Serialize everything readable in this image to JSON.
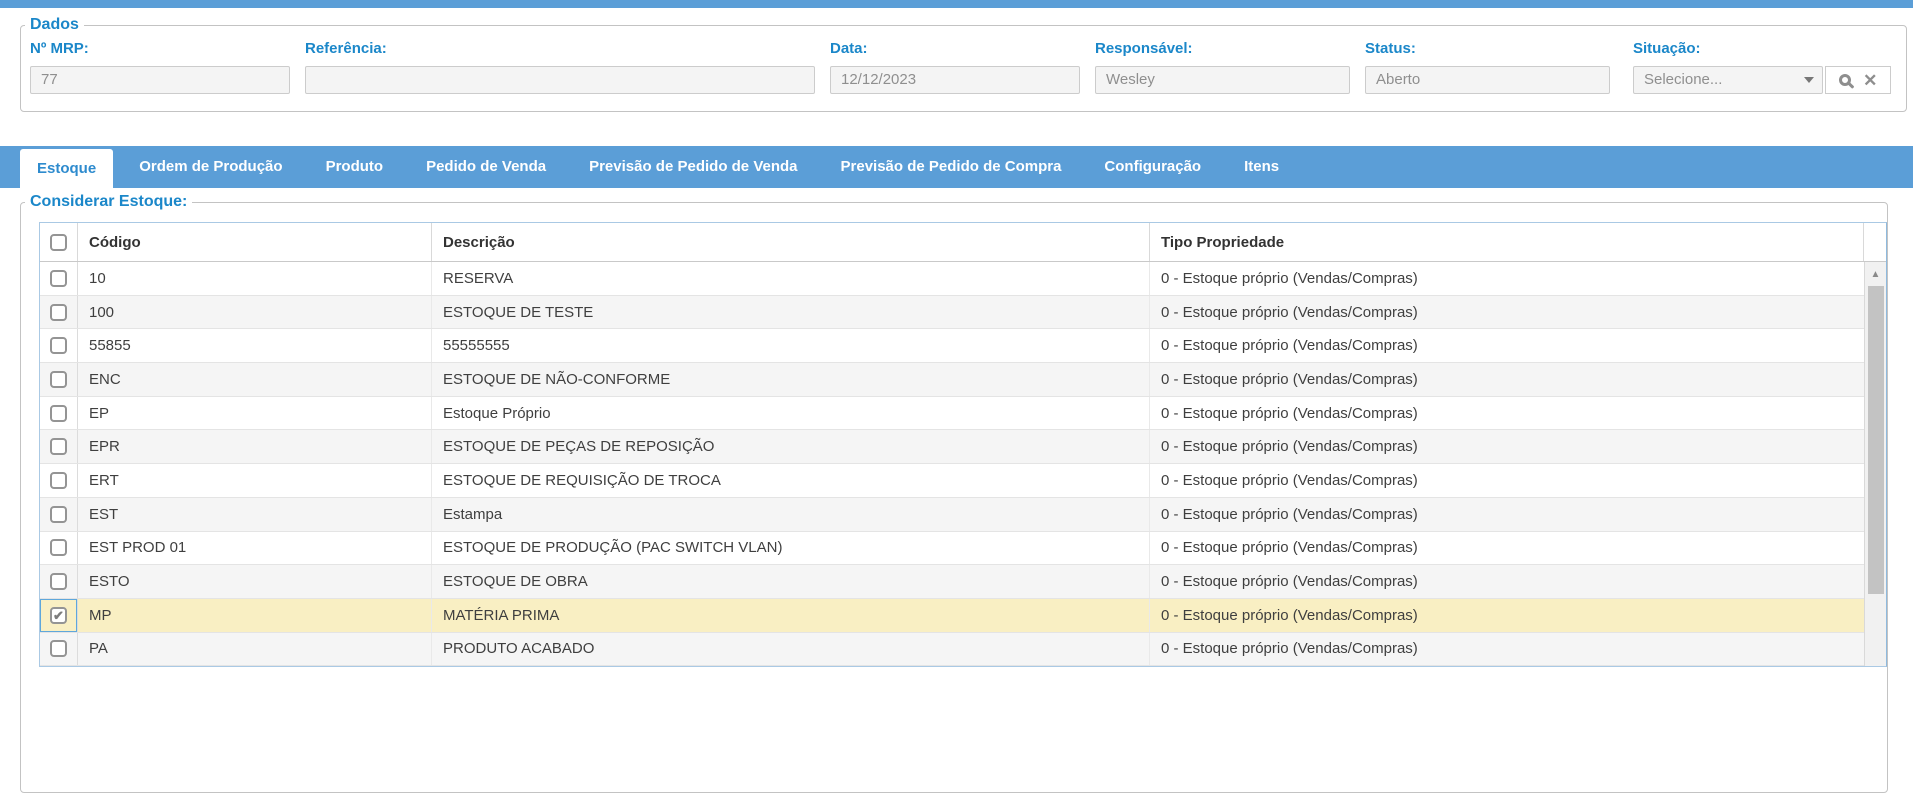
{
  "colors": {
    "accent_blue": "#1b87c9",
    "bar_blue": "#5b9ed7",
    "highlight_yellow": "#f9efc3"
  },
  "dados": {
    "legend": "Dados",
    "fields": [
      {
        "id": "n-mrp",
        "label": "Nº MRP:",
        "value": "77",
        "type": "text"
      },
      {
        "id": "referencia",
        "label": "Referência:",
        "value": "",
        "type": "text"
      },
      {
        "id": "data",
        "label": "Data:",
        "value": "12/12/2023",
        "type": "text"
      },
      {
        "id": "responsavel",
        "label": "Responsável:",
        "value": "Wesley",
        "type": "text"
      },
      {
        "id": "status",
        "label": "Status:",
        "value": "Aberto",
        "type": "text"
      },
      {
        "id": "situacao",
        "label": "Situação:",
        "value": "Selecione...",
        "type": "select",
        "icons": [
          "dropdown-arrow-icon",
          "search-icon",
          "clear-icon"
        ]
      }
    ]
  },
  "tabs": [
    {
      "label": "Estoque",
      "active": true
    },
    {
      "label": "Ordem de Produção",
      "active": false
    },
    {
      "label": "Produto",
      "active": false
    },
    {
      "label": "Pedido de Venda",
      "active": false
    },
    {
      "label": "Previsão de Pedido de Venda",
      "active": false
    },
    {
      "label": "Previsão de Pedido de Compra",
      "active": false
    },
    {
      "label": "Configuração",
      "active": false
    },
    {
      "label": "Itens",
      "active": false
    }
  ],
  "estoque_panel": {
    "legend": "Considerar Estoque:",
    "columns": [
      "Código",
      "Descrição",
      "Tipo Propriedade"
    ],
    "rows": [
      {
        "codigo": "10",
        "descricao": "RESERVA",
        "tipo": "0 - Estoque próprio (Vendas/Compras)",
        "checked": false,
        "highlighted": false
      },
      {
        "codigo": "100",
        "descricao": "ESTOQUE DE TESTE",
        "tipo": "0 - Estoque próprio (Vendas/Compras)",
        "checked": false,
        "highlighted": false
      },
      {
        "codigo": "55855",
        "descricao": "55555555",
        "tipo": "0 - Estoque próprio (Vendas/Compras)",
        "checked": false,
        "highlighted": false
      },
      {
        "codigo": "ENC",
        "descricao": "ESTOQUE DE NÃO-CONFORME",
        "tipo": "0 - Estoque próprio (Vendas/Compras)",
        "checked": false,
        "highlighted": false
      },
      {
        "codigo": "EP",
        "descricao": "Estoque Próprio",
        "tipo": "0 - Estoque próprio (Vendas/Compras)",
        "checked": false,
        "highlighted": false
      },
      {
        "codigo": "EPR",
        "descricao": "ESTOQUE DE PEÇAS DE REPOSIÇÃO",
        "tipo": "0 - Estoque próprio (Vendas/Compras)",
        "checked": false,
        "highlighted": false
      },
      {
        "codigo": "ERT",
        "descricao": "ESTOQUE DE REQUISIÇÃO DE TROCA",
        "tipo": "0 - Estoque próprio (Vendas/Compras)",
        "checked": false,
        "highlighted": false
      },
      {
        "codigo": "EST",
        "descricao": "Estampa",
        "tipo": "0 - Estoque próprio (Vendas/Compras)",
        "checked": false,
        "highlighted": false
      },
      {
        "codigo": "EST PROD 01",
        "descricao": "ESTOQUE DE PRODUÇÃO (PAC SWITCH VLAN)",
        "tipo": "0 - Estoque próprio (Vendas/Compras)",
        "checked": false,
        "highlighted": false
      },
      {
        "codigo": "ESTO",
        "descricao": "ESTOQUE DE OBRA",
        "tipo": "0 - Estoque próprio (Vendas/Compras)",
        "checked": false,
        "highlighted": false
      },
      {
        "codigo": "MP",
        "descricao": "MATÉRIA PRIMA",
        "tipo": "0 - Estoque próprio (Vendas/Compras)",
        "checked": true,
        "highlighted": true
      },
      {
        "codigo": "PA",
        "descricao": "PRODUTO ACABADO",
        "tipo": "0 - Estoque próprio (Vendas/Compras)",
        "checked": false,
        "highlighted": false
      }
    ]
  },
  "scrollbar": {
    "up_arrow": "▲"
  }
}
